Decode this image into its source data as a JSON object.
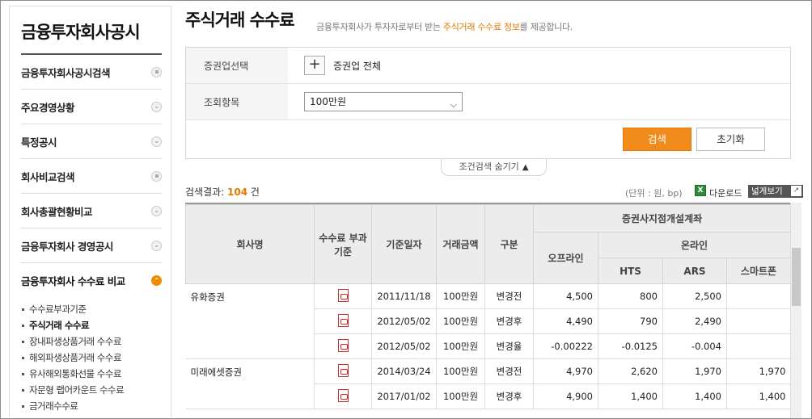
{
  "sidebar": {
    "title": "금융투자회사공시",
    "items": [
      {
        "label": "금융투자회사공시검색"
      },
      {
        "label": "주요경영상황"
      },
      {
        "label": "특정공시"
      },
      {
        "label": "회사비교검색"
      },
      {
        "label": "회사총괄현황비교"
      },
      {
        "label": "금융투자회사 경영공시"
      },
      {
        "label": "금융투자회사 수수료 비교"
      }
    ],
    "subitems": [
      {
        "label": "수수료부과기준"
      },
      {
        "label": "주식거래 수수료"
      },
      {
        "label": "장내파생상품거래 수수료"
      },
      {
        "label": "해외파생상품거래 수수료"
      },
      {
        "label": "유사해외통화선물 수수료"
      },
      {
        "label": "자문형 랩어카운트 수수료"
      },
      {
        "label": "금거래수수료"
      }
    ]
  },
  "header": {
    "title": "주식거래 수수료",
    "desc_pre": "금융투자회사가 투자자로부터 받는 ",
    "desc_hl": "주식거래 수수료 정보",
    "desc_post": "를 제공합니다."
  },
  "search": {
    "broker_label": "증권업선택",
    "broker_value": "증권업 전체",
    "item_label": "조회항목",
    "item_value": "100만원",
    "search_btn": "검색",
    "reset_btn": "초기화",
    "toggle": "조건검색 숨기기"
  },
  "result": {
    "prefix": "검색결과: ",
    "count": "104",
    "suffix": " 건",
    "unit": "(단위 : 원, bp)",
    "download": "다운로드",
    "wide": "넓게보기"
  },
  "table": {
    "headers": {
      "company": "회사명",
      "fee_basis": "수수료 부과기준",
      "date": "기준일자",
      "amount": "거래금액",
      "type": "구분",
      "group": "증권사지점개설계좌",
      "offline": "오프라인",
      "online": "온라인",
      "hts": "HTS",
      "ars": "ARS",
      "smart": "스마트폰"
    },
    "rows": [
      {
        "company": "유화증권",
        "date": "2011/11/18",
        "amount": "100만원",
        "type": "변경전",
        "offline": "4,500",
        "hts": "800",
        "ars": "2,500",
        "smart": ""
      },
      {
        "company": "",
        "date": "2012/05/02",
        "amount": "100만원",
        "type": "변경후",
        "offline": "4,490",
        "hts": "790",
        "ars": "2,490",
        "smart": ""
      },
      {
        "company": "",
        "date": "2012/05/02",
        "amount": "100만원",
        "type": "변경율",
        "offline": "-0.00222",
        "hts": "-0.0125",
        "ars": "-0.004",
        "smart": ""
      },
      {
        "company": "미래에셋증권",
        "date": "2014/03/24",
        "amount": "100만원",
        "type": "변경전",
        "offline": "4,970",
        "hts": "2,620",
        "ars": "1,970",
        "smart": "1,970"
      },
      {
        "company": "",
        "date": "2017/01/02",
        "amount": "100만원",
        "type": "변경후",
        "offline": "4,900",
        "hts": "1,400",
        "ars": "1,400",
        "smart": "1,400"
      }
    ]
  }
}
